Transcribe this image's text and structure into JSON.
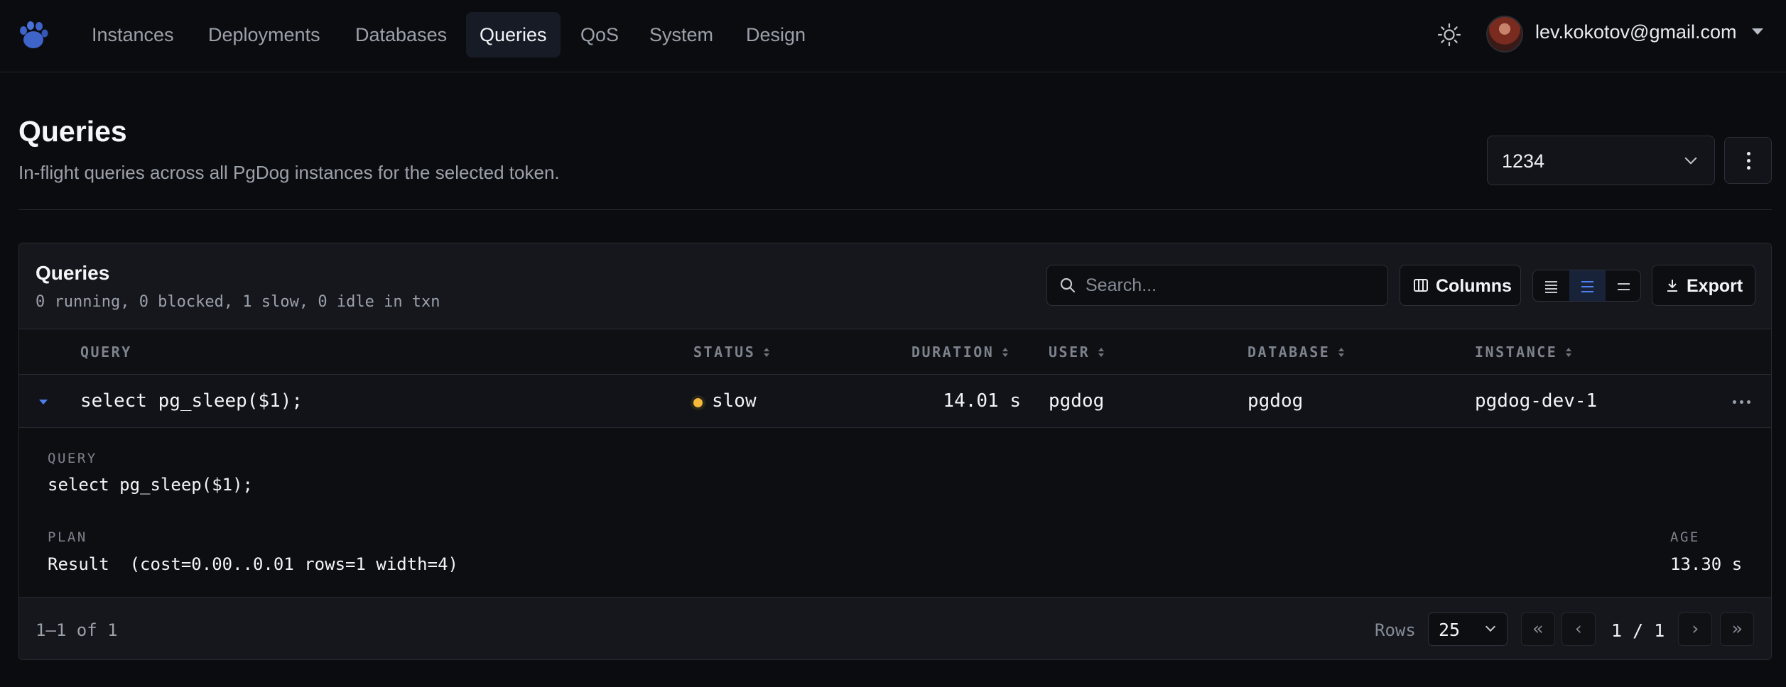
{
  "nav": {
    "items": [
      {
        "label": "Instances",
        "active": false
      },
      {
        "label": "Deployments",
        "active": false
      },
      {
        "label": "Databases",
        "active": false
      },
      {
        "label": "Queries",
        "active": true
      },
      {
        "label": "QoS",
        "active": false
      },
      {
        "label": "System",
        "active": false
      },
      {
        "label": "Design",
        "active": false
      }
    ],
    "theme_icon": "sun-icon",
    "user_email": "lev.kokotov@gmail.com"
  },
  "page": {
    "title": "Queries",
    "subtitle": "In-flight queries across all PgDog instances for the selected token.",
    "token_value": "1234"
  },
  "panel": {
    "title": "Queries",
    "summary": "0 running, 0 blocked, 1 slow, 0 idle in txn",
    "search_placeholder": "Search...",
    "columns_label": "Columns",
    "export_label": "Export",
    "density_selected": "comfortable",
    "columns": [
      "QUERY",
      "STATUS",
      "DURATION",
      "USER",
      "DATABASE",
      "INSTANCE"
    ],
    "rows": [
      {
        "query": "select pg_sleep($1);",
        "status": "slow",
        "duration": "14.01 s",
        "user": "pgdog",
        "database": "pgdog",
        "instance": "pgdog-dev-1",
        "expanded": true
      }
    ],
    "detail": {
      "query_label": "QUERY",
      "query": "select pg_sleep($1);",
      "plan_label": "PLAN",
      "plan": "Result  (cost=0.00..0.01 rows=1 width=4)",
      "age_label": "AGE",
      "age": "13.30 s"
    },
    "footer": {
      "range": "1–1 of 1",
      "rows_label": "Rows",
      "rows_per_page": "25",
      "page": "1 / 1",
      "first": "«",
      "prev": "‹",
      "next": "›",
      "last": "»"
    }
  },
  "colors": {
    "accent": "#4d7ff0",
    "slow_status": "#f5b93b",
    "background": "#0b0c0f"
  }
}
